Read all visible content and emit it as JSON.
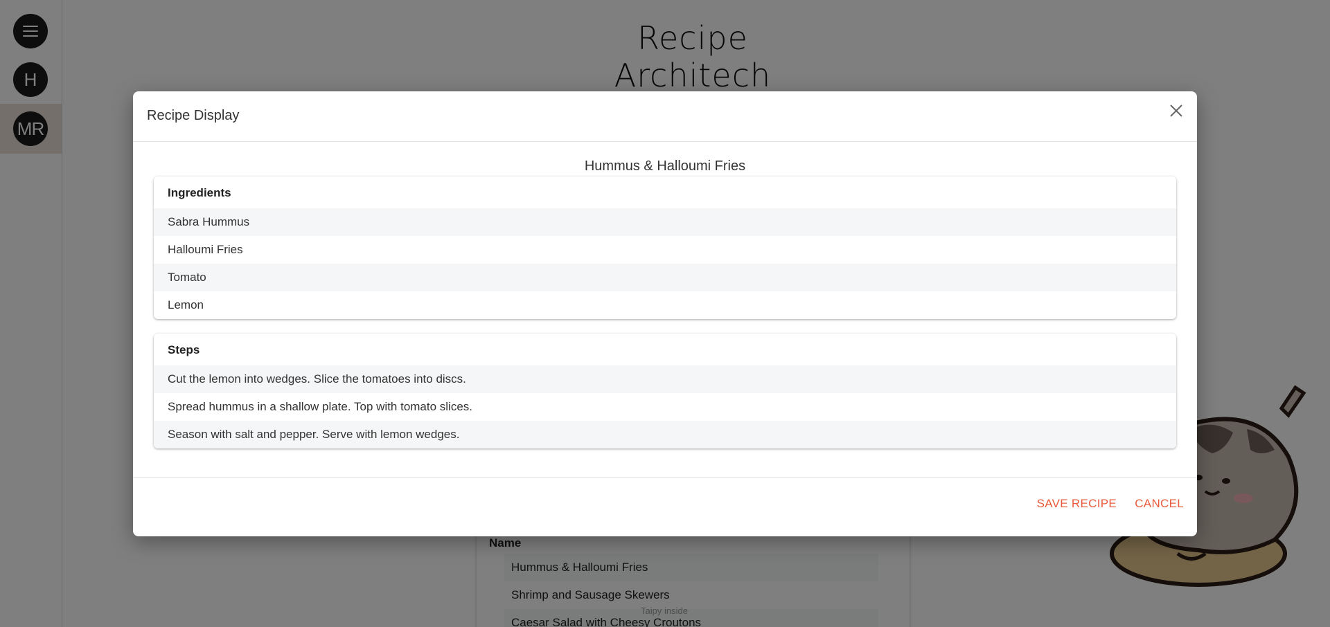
{
  "rail": {
    "user_initial": "H",
    "active_initials": "MR"
  },
  "background": {
    "app_title": "Recipe Architech",
    "list_header": "Name",
    "list_rows": [
      "Hummus & Halloumi Fries",
      "Shrimp and Sausage Skewers",
      "Caesar Salad with Cheesy Croutons"
    ],
    "small_text": "Taipy inside"
  },
  "modal": {
    "title": "Recipe Display",
    "recipe_name": "Hummus & Halloumi Fries",
    "ingredients_header": "Ingredients",
    "ingredients": [
      "Sabra Hummus",
      "Halloumi Fries",
      "Tomato",
      "Lemon"
    ],
    "steps_header": "Steps",
    "steps": [
      "Cut the lemon into wedges. Slice the tomatoes into discs.",
      "Spread hummus in a shallow plate. Top with tomato slices.",
      "Season with salt and pepper. Serve with lemon wedges."
    ],
    "save_label": "SAVE RECIPE",
    "cancel_label": "CANCEL"
  },
  "colors": {
    "accent": "#e85a3c",
    "rail_button": "#1b1b1b",
    "active_rail_bg": "#eadfd9"
  },
  "icons": [
    "menu-icon",
    "close-icon",
    "cat-illustration"
  ]
}
